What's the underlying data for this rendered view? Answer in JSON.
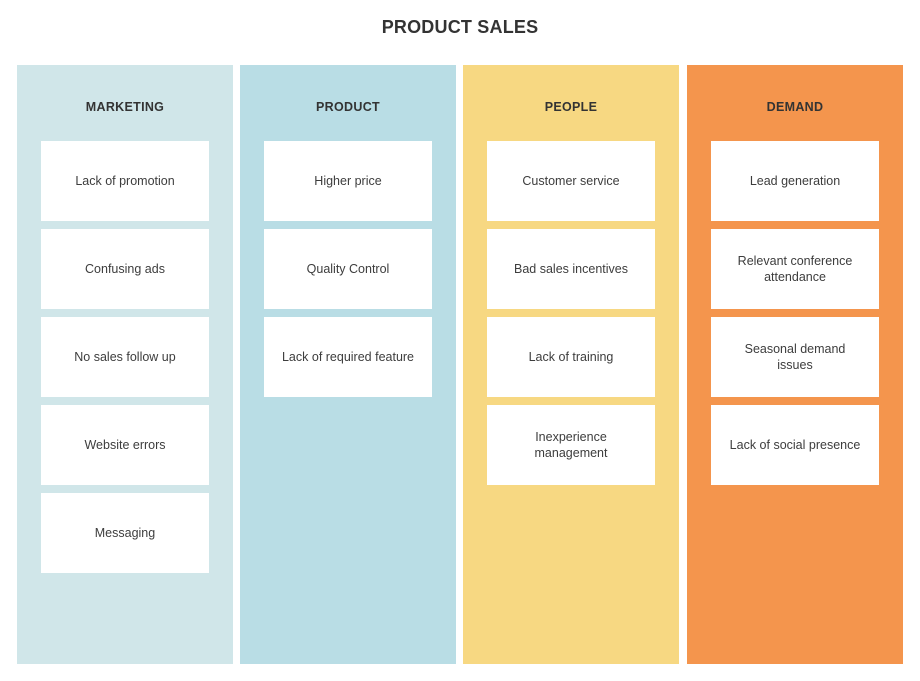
{
  "title": "PRODUCT SALES",
  "columns": [
    {
      "label": "MARKETING",
      "color": "#d0e6e9",
      "cards": [
        "Lack of promotion",
        "Confusing ads",
        "No sales follow up",
        "Website errors",
        "Messaging"
      ]
    },
    {
      "label": "PRODUCT",
      "color": "#b9dde5",
      "cards": [
        "Higher price",
        "Quality Control",
        "Lack of required feature"
      ]
    },
    {
      "label": "PEOPLE",
      "color": "#f7d882",
      "cards": [
        "Customer service",
        "Bad sales incentives",
        "Lack of training",
        "Inexperience management"
      ]
    },
    {
      "label": "DEMAND",
      "color": "#f4954d",
      "cards": [
        "Lead generation",
        "Relevant conference attendance",
        "Seasonal demand issues",
        "Lack of social presence"
      ]
    }
  ]
}
